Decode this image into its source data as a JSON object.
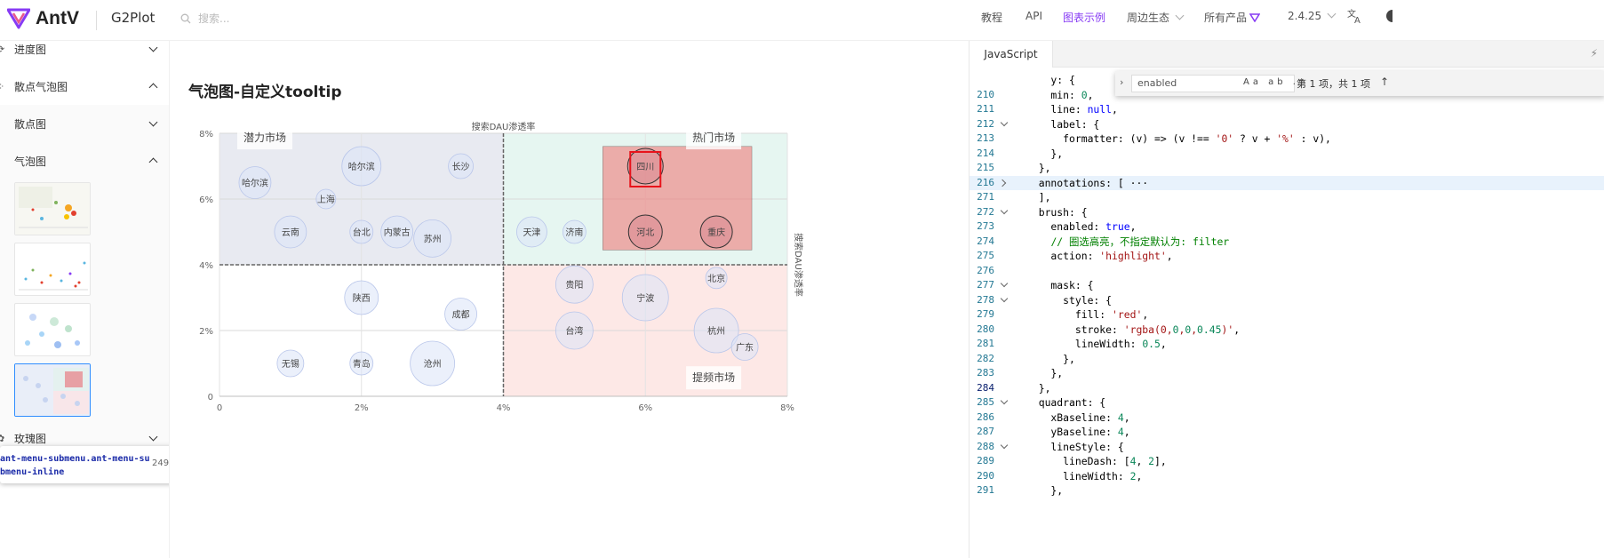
{
  "header": {
    "logo_text": "AntV",
    "product": "G2Plot",
    "search_placeholder": "搜索...",
    "nav": [
      "教程",
      "API",
      "图表示例",
      "周边生态",
      "所有产品",
      "2.4.25"
    ],
    "active_nav": "图表示例",
    "accent": "#873bf4"
  },
  "sidebar": {
    "items": [
      {
        "label": "进度图",
        "icon": "⟳",
        "arrow": "down"
      },
      {
        "label": "散点气泡图",
        "icon": "⁘",
        "arrow": "up"
      },
      {
        "label": "散点图",
        "arrow": "down"
      },
      {
        "label": "气泡图",
        "arrow": "up"
      },
      {
        "label": "玫瑰图",
        "icon": "✿",
        "arrow": "down"
      }
    ],
    "inspector": {
      "selector": "ant-menu-submenu.ant-menu-submenu-inline",
      "size": "249 × 44.02"
    }
  },
  "main": {
    "title": "气泡图-自定义tooltip"
  },
  "chart_data": {
    "type": "scatter",
    "title": "",
    "xlabel": "",
    "ylabel": "搜索DAU渗透率",
    "top_axis_label": "搜索DAU渗透率",
    "xlim": [
      0,
      8
    ],
    "ylim": [
      0,
      8
    ],
    "x_ticks": [
      "0",
      "2%",
      "4%",
      "6%",
      "8%"
    ],
    "y_ticks": [
      "0",
      "2%",
      "4%",
      "6%",
      "8%"
    ],
    "quadrant": {
      "xBaseline": 4,
      "yBaseline": 4
    },
    "quadrant_labels": [
      "潜力市场",
      "热门市场",
      "提频市场"
    ],
    "quadrant_colors": [
      "#e8eaf1",
      "#e6f6f1",
      "#fde8e6",
      "#ffffff"
    ],
    "brush": {
      "x": [
        5.4,
        7.5
      ],
      "y": [
        4.45,
        7.6
      ],
      "fill": "#ee7c7a"
    },
    "selected": "四川",
    "points": [
      {
        "name": "哈尔滨",
        "x": 0.5,
        "y": 6.5,
        "r": 18
      },
      {
        "name": "哈尔滨",
        "x": 2.0,
        "y": 7.0,
        "r": 22
      },
      {
        "name": "长沙",
        "x": 3.4,
        "y": 7.0,
        "r": 14
      },
      {
        "name": "上海",
        "x": 1.5,
        "y": 6.0,
        "r": 11
      },
      {
        "name": "云南",
        "x": 1.0,
        "y": 5.0,
        "r": 18
      },
      {
        "name": "台北",
        "x": 2.0,
        "y": 5.0,
        "r": 13
      },
      {
        "name": "内蒙古",
        "x": 2.5,
        "y": 5.0,
        "r": 18
      },
      {
        "name": "苏州",
        "x": 3.0,
        "y": 4.8,
        "r": 21
      },
      {
        "name": "天津",
        "x": 4.4,
        "y": 5.0,
        "r": 17
      },
      {
        "name": "济南",
        "x": 5.0,
        "y": 5.0,
        "r": 13
      },
      {
        "name": "四川",
        "x": 6.0,
        "y": 7.0,
        "r": 20
      },
      {
        "name": "河北",
        "x": 6.0,
        "y": 5.0,
        "r": 19
      },
      {
        "name": "重庆",
        "x": 7.0,
        "y": 5.0,
        "r": 18
      },
      {
        "name": "陕西",
        "x": 2.0,
        "y": 3.0,
        "r": 19
      },
      {
        "name": "成都",
        "x": 3.4,
        "y": 2.5,
        "r": 18
      },
      {
        "name": "贵阳",
        "x": 5.0,
        "y": 3.4,
        "r": 21
      },
      {
        "name": "宁波",
        "x": 6.0,
        "y": 3.0,
        "r": 26
      },
      {
        "name": "北京",
        "x": 7.0,
        "y": 3.6,
        "r": 12
      },
      {
        "name": "台湾",
        "x": 5.0,
        "y": 2.0,
        "r": 21
      },
      {
        "name": "杭州",
        "x": 7.0,
        "y": 2.0,
        "r": 25
      },
      {
        "name": "广东",
        "x": 7.4,
        "y": 1.5,
        "r": 15
      },
      {
        "name": "无锡",
        "x": 1.0,
        "y": 1.0,
        "r": 15
      },
      {
        "name": "青岛",
        "x": 2.0,
        "y": 1.0,
        "r": 13
      },
      {
        "name": "沧州",
        "x": 3.0,
        "y": 1.0,
        "r": 25
      }
    ]
  },
  "code": {
    "tab": "JavaScript",
    "find": {
      "query": "enabled",
      "count": "第 1 项，共 1 项",
      "options": "Aa ab .*"
    },
    "lines": [
      {
        "n": "",
        "t": "    y: {"
      },
      {
        "n": "210",
        "t": "    min: 0,"
      },
      {
        "n": "211",
        "t": "    line: null,"
      },
      {
        "n": "212",
        "t": "    label: {",
        "f": "open"
      },
      {
        "n": "213",
        "t": "      formatter: (v) => (v !== '0' ? v + '%' : v),"
      },
      {
        "n": "214",
        "t": "    },"
      },
      {
        "n": "215",
        "t": "  },"
      },
      {
        "n": "216",
        "t": "  annotations: [ ···",
        "f": "closed",
        "hl": true
      },
      {
        "n": "271",
        "t": "  ],"
      },
      {
        "n": "272",
        "t": "  brush: {",
        "f": "open"
      },
      {
        "n": "273",
        "t": "    enabled: true,"
      },
      {
        "n": "274",
        "t": "    // 圈选高亮，不指定默认为: filter"
      },
      {
        "n": "275",
        "t": "    action: 'highlight',"
      },
      {
        "n": "276",
        "t": ""
      },
      {
        "n": "277",
        "t": "    mask: {",
        "f": "open"
      },
      {
        "n": "278",
        "t": "      style: {",
        "f": "open"
      },
      {
        "n": "279",
        "t": "        fill: 'red',"
      },
      {
        "n": "280",
        "t": "        stroke: 'rgba(0,0,0,0.45)',"
      },
      {
        "n": "281",
        "t": "        lineWidth: 0.5,"
      },
      {
        "n": "282",
        "t": "      },"
      },
      {
        "n": "283",
        "t": "    },"
      },
      {
        "n": "284",
        "t": "  },",
        "cur": true
      },
      {
        "n": "285",
        "t": "  quadrant: {",
        "f": "open"
      },
      {
        "n": "286",
        "t": "    xBaseline: 4,"
      },
      {
        "n": "287",
        "t": "    yBaseline: 4,"
      },
      {
        "n": "288",
        "t": "    lineStyle: {",
        "f": "open"
      },
      {
        "n": "289",
        "t": "      lineDash: [4, 2],"
      },
      {
        "n": "290",
        "t": "      lineWidth: 2,"
      },
      {
        "n": "291",
        "t": "    },"
      }
    ]
  }
}
